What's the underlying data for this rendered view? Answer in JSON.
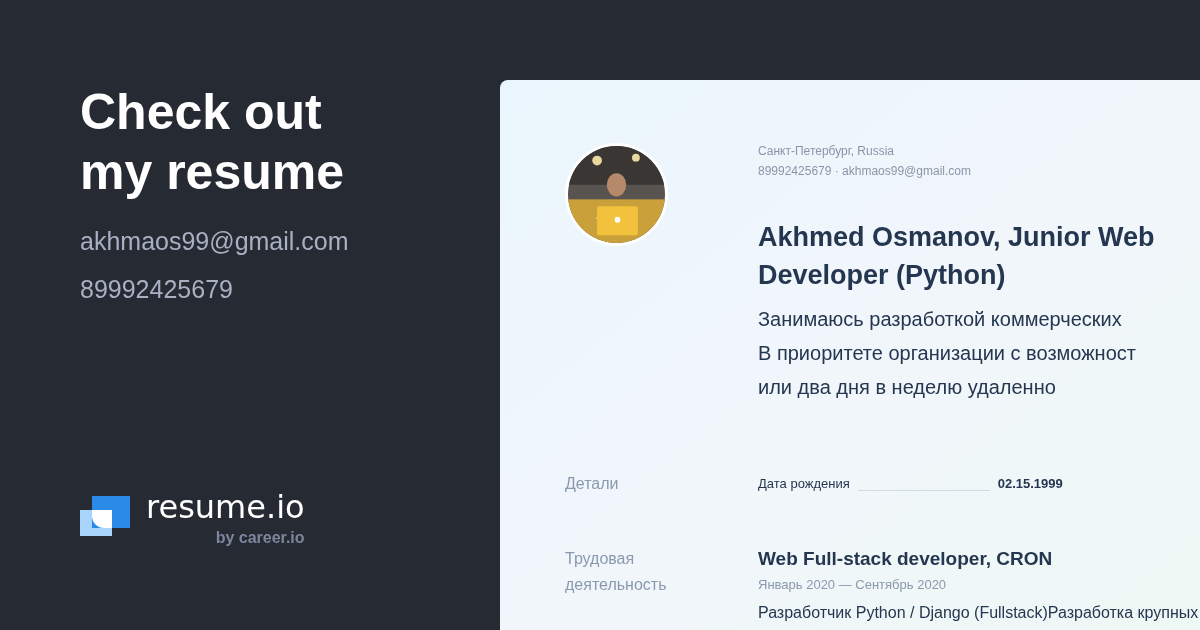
{
  "headline": "Check out my resume",
  "contact": {
    "email": "akhmaos99@gmail.com",
    "phone": "89992425679"
  },
  "brand": {
    "name": "resume.io",
    "tagline": "by career.io"
  },
  "resume": {
    "location": "Санкт-Петербург, Russia",
    "contacts": "89992425679 · akhmaos99@gmail.com",
    "title_lines": [
      "Akhmed Osmanov, Junior Web",
      "Developer (Python)"
    ],
    "summary_lines": [
      "Занимаюсь разработкой коммерческих",
      "В приоритете организации с возможност",
      "или два дня в неделю удаленно"
    ],
    "details": {
      "heading": "Детали",
      "label": "Дата рождения",
      "value": "02.15.1999"
    },
    "experience": {
      "heading_lines": [
        "Трудовая",
        "деятельность"
      ],
      "job_title": "Web Full-stack developer, CRON",
      "dates": "Январь 2020 — Сентябрь 2020",
      "description": "Разработчик Python / Django (Fullstack)Разработка крупных"
    }
  }
}
